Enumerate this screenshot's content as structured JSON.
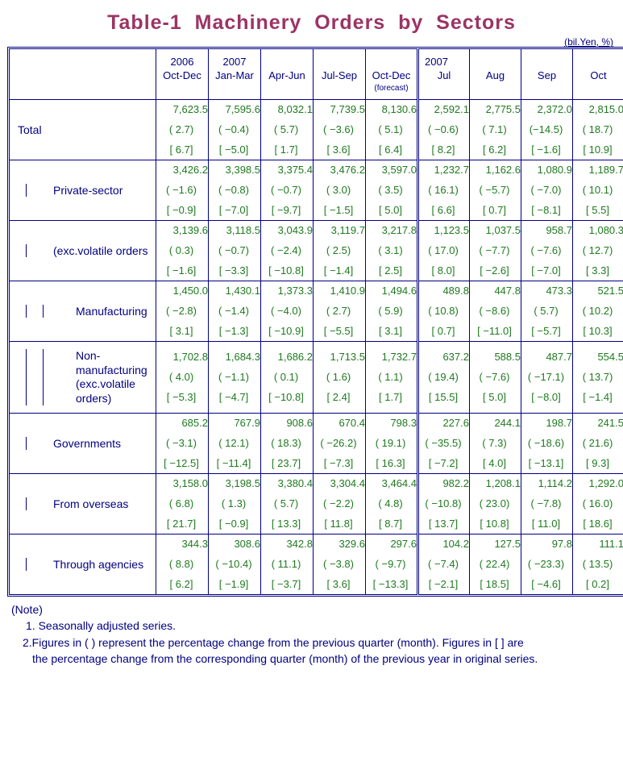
{
  "title": "Table-1  Machinery  Orders  by  Sectors",
  "units_note": "(bil.Yen, %)",
  "header": {
    "corner": "",
    "quarters": [
      {
        "year": "2006",
        "period": "Oct-Dec",
        "sub": ""
      },
      {
        "year": "2007",
        "period": "Jan-Mar",
        "sub": ""
      },
      {
        "year": "",
        "period": "Apr-Jun",
        "sub": ""
      },
      {
        "year": "",
        "period": "Jul-Sep",
        "sub": ""
      },
      {
        "year": "",
        "period": "Oct-Dec",
        "sub": "(forecast)"
      }
    ],
    "months": [
      {
        "year": "2007",
        "period": "Jul",
        "sub": ""
      },
      {
        "year": "",
        "period": "Aug",
        "sub": ""
      },
      {
        "year": "",
        "period": "Sep",
        "sub": ""
      },
      {
        "year": "",
        "period": "Oct",
        "sub": ""
      }
    ]
  },
  "rows": [
    {
      "label": "Total",
      "label2": "",
      "level": 0,
      "values": [
        "7,623.5",
        "7,595.6",
        "8,032.1",
        "7,739.5",
        "8,130.6",
        "2,592.1",
        "2,775.5",
        "2,372.0",
        "2,815.0"
      ],
      "paren": [
        "( 2.7)",
        "( −0.4)",
        "( 5.7)",
        "( −3.6)",
        "( 5.1)",
        "( −0.6)",
        "( 7.1)",
        "(−14.5)",
        "( 18.7)"
      ],
      "bracket": [
        "[ 6.7]",
        "[ −5.0]",
        "[ 1.7]",
        "[ 3.6]",
        "[ 6.4]",
        "[ 8.2]",
        "[ 6.2]",
        "[ −1.6]",
        "[ 10.9]"
      ]
    },
    {
      "label": "Private-sector",
      "label2": "",
      "level": 1,
      "values": [
        "3,426.2",
        "3,398.5",
        "3,375.4",
        "3,476.2",
        "3,597.0",
        "1,232.7",
        "1,162.6",
        "1,080.9",
        "1,189.7"
      ],
      "paren": [
        "( −1.6)",
        "( −0.8)",
        "( −0.7)",
        "( 3.0)",
        "( 3.5)",
        "( 16.1)",
        "( −5.7)",
        "( −7.0)",
        "( 10.1)"
      ],
      "bracket": [
        "[ −0.9]",
        "[ −7.0]",
        "[ −9.7]",
        "[ −1.5]",
        "[ 5.0]",
        "[ 6.6]",
        "[ 0.7]",
        "[ −8.1]",
        "[ 5.5]"
      ]
    },
    {
      "label": "(exc.volatile orders",
      "label2": "",
      "level": 1,
      "values": [
        "3,139.6",
        "3,118.5",
        "3,043.9",
        "3,119.7",
        "3,217.8",
        "1,123.5",
        "1,037.5",
        "958.7",
        "1,080.3"
      ],
      "paren": [
        "( 0.3)",
        "( −0.7)",
        "( −2.4)",
        "( 2.5)",
        "( 3.1)",
        "( 17.0)",
        "( −7.7)",
        "( −7.6)",
        "( 12.7)"
      ],
      "bracket": [
        "[ −1.6]",
        "[ −3.3]",
        "[ −10.8]",
        "[ −1.4]",
        "[ 2.5]",
        "[ 8.0]",
        "[ −2.6]",
        "[ −7.0]",
        "[ 3.3]"
      ]
    },
    {
      "label": "Manufacturing",
      "label2": "",
      "level": 2,
      "values": [
        "1,450.0",
        "1,430.1",
        "1,373.3",
        "1,410.9",
        "1,494.6",
        "489.8",
        "447.8",
        "473.3",
        "521.5"
      ],
      "paren": [
        "( −2.8)",
        "( −1.4)",
        "( −4.0)",
        "( 2.7)",
        "( 5.9)",
        "( 10.8)",
        "( −8.6)",
        "( 5.7)",
        "( 10.2)"
      ],
      "bracket": [
        "[ 3.1]",
        "[ −1.3]",
        "[ −10.9]",
        "[ −5.5]",
        "[ 3.1]",
        "[ 0.7]",
        "[ −11.0]",
        "[ −5.7]",
        "[ 10.3]"
      ]
    },
    {
      "label": "Non-manufacturing",
      "label2": "(exc.volatile orders)",
      "level": 2,
      "values": [
        "1,702.8",
        "1,684.3",
        "1,686.2",
        "1,713.5",
        "1,732.7",
        "637.2",
        "588.5",
        "487.7",
        "554.5"
      ],
      "paren": [
        "( 4.0)",
        "( −1.1)",
        "( 0.1)",
        "( 1.6)",
        "( 1.1)",
        "( 19.4)",
        "( −7.6)",
        "( −17.1)",
        "( 13.7)"
      ],
      "bracket": [
        "[ −5.3]",
        "[ −4.7]",
        "[ −10.8]",
        "[ 2.4]",
        "[ 1.7]",
        "[ 15.5]",
        "[ 5.0]",
        "[ −8.0]",
        "[ −1.4]"
      ]
    },
    {
      "label": "Governments",
      "label2": "",
      "level": 1,
      "values": [
        "685.2",
        "767.9",
        "908.6",
        "670.4",
        "798.3",
        "227.6",
        "244.1",
        "198.7",
        "241.5"
      ],
      "paren": [
        "( −3.1)",
        "( 12.1)",
        "( 18.3)",
        "( −26.2)",
        "( 19.1)",
        "( −35.5)",
        "( 7.3)",
        "( −18.6)",
        "( 21.6)"
      ],
      "bracket": [
        "[ −12.5]",
        "[ −11.4]",
        "[ 23.7]",
        "[ −7.3]",
        "[ 16.3]",
        "[ −7.2]",
        "[ 4.0]",
        "[ −13.1]",
        "[ 9.3]"
      ]
    },
    {
      "label": "From overseas",
      "label2": "",
      "level": 1,
      "values": [
        "3,158.0",
        "3,198.5",
        "3,380.4",
        "3,304.4",
        "3,464.4",
        "982.2",
        "1,208.1",
        "1,114.2",
        "1,292.0"
      ],
      "paren": [
        "( 6.8)",
        "( 1.3)",
        "( 5.7)",
        "( −2.2)",
        "( 4.8)",
        "( −10.8)",
        "( 23.0)",
        "( −7.8)",
        "( 16.0)"
      ],
      "bracket": [
        "[ 21.7]",
        "[ −0.9]",
        "[ 13.3]",
        "[ 11.8]",
        "[ 8.7]",
        "[ 13.7]",
        "[ 10.8]",
        "[ 11.0]",
        "[ 18.6]"
      ]
    },
    {
      "label": "Through agencies",
      "label2": "",
      "level": 1,
      "values": [
        "344.3",
        "308.6",
        "342.8",
        "329.6",
        "297.6",
        "104.2",
        "127.5",
        "97.8",
        "111.1"
      ],
      "paren": [
        "( 8.8)",
        "( −10.4)",
        "( 11.1)",
        "( −3.8)",
        "( −9.7)",
        "( −7.4)",
        "( 22.4)",
        "( −23.3)",
        "( 13.5)"
      ],
      "bracket": [
        "[ 6.2]",
        "[ −1.9]",
        "[ −3.7]",
        "[ 3.6]",
        "[ −13.3]",
        "[ −2.1]",
        "[ 18.5]",
        "[ −4.6]",
        "[ 0.2]"
      ]
    }
  ],
  "notes": {
    "heading": "(Note)",
    "line1": "1. Seasonally adjusted series.",
    "line2a": "2.Figures in ( ) represent the percentage change from the previous quarter (month). Figures in [ ] are",
    "line2b": "the percentage change from the corresponding quarter (month) of the previous year in original series."
  },
  "colors": {
    "title": "#9B3464",
    "text": "#000080",
    "numbers": "#1F7A1F",
    "border": "#000080",
    "background": "#FFFFFF"
  }
}
